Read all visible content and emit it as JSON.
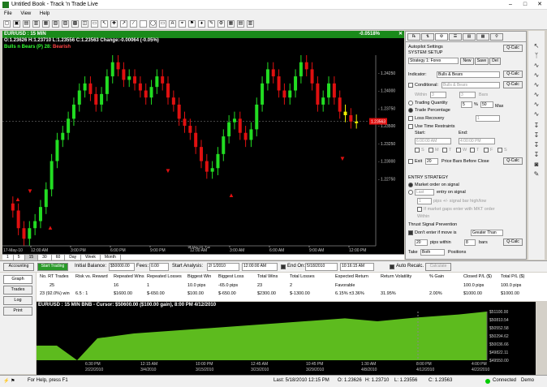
{
  "window": {
    "title": "Untitled Book - Track 'n Trade Live"
  },
  "menu": [
    "File",
    "View",
    "Help"
  ],
  "chart": {
    "header": "EUR/USD : 15 MIN",
    "change_pct": "-0.0518%",
    "ohlc": "O:1.23626   H:1.23710   L:1.23556   C:1.23563   Change:-0.00064 (-0.05%)",
    "indicator": "Bulls n Bears (P) 28:",
    "indicator_state": "Bearish",
    "price_labels": [
      "1.24250",
      "1.24000",
      "1.23750",
      "1.23500",
      "1.23250",
      "1.23000",
      "1.22750"
    ],
    "price_tag_bid": "1.23563",
    "price_tag_ask": "1.23563",
    "time_labels": [
      "12:00 AM",
      "3:00 PM",
      "6:00 PM",
      "9:00 PM",
      "12:00 AM",
      "3:00 AM",
      "6:00 AM",
      "9:00 AM",
      "12:00 PM"
    ],
    "date_labels": [
      "15-May-10, Sat",
      "18-May-10, Tue"
    ],
    "axis_corner_left": "17-May-10"
  },
  "tf_tabs": [
    "1",
    "5",
    "15",
    "30",
    "60",
    "Day",
    "Week",
    "Month"
  ],
  "panel": {
    "title": "Autopilot Settings",
    "subtitle": "SYSTEM SETUP",
    "strategy": "Strategy 1: Forex",
    "new": "New",
    "save": "Save",
    "del": "Del",
    "qcalc": "Q-Calc",
    "indicator_label": "Indicator:",
    "indicator_value": "Bulls & Bears",
    "conditional": "Conditional:",
    "conditional_value": "Bulls & Bears",
    "within": "Within",
    "within_val": "3",
    "bars_val": "3",
    "bars": "Bars",
    "trading_qty": "Trading Quantity",
    "trade_pct": "Trade Percentage",
    "trade_pct_val": "5",
    "pct_sym": "%",
    "max_val": "50",
    "max": "Max",
    "loss_recovery": "Loss Recovery",
    "loss_val": "1",
    "use_time": "Use Time Restraints",
    "start": "Start:",
    "end": "End:",
    "start_time": "6:00:00 AM",
    "end_time": "4:00:00 PM",
    "days": [
      "S",
      "M",
      "T",
      "W",
      "T",
      "F",
      "S"
    ],
    "exit": "Exit",
    "exit_val": "20",
    "price_bars_before_close": "Price Bars Before Close",
    "entry_strategy": "ENTRY STRATEGY",
    "market_order": "Market order on signal",
    "last": "Last",
    "entry_on_signal": "entry on signal",
    "pips_hint": "pips +/- signal bar high/low",
    "pips_val": "1",
    "if_market_gaps": "If market gaps enter with MKT order",
    "within_label": "Within",
    "thrust": "Thrust Signal Prevention",
    "dont_enter": "Don't enter if move is",
    "greater_than": "Greater Than",
    "pips_val2": "20",
    "pips_within": "pips within",
    "bars_val2": "8",
    "bars2": "bars",
    "take": "Take",
    "both": "Both",
    "positions": "Positions"
  },
  "strip": {
    "accounting": "Accounting",
    "start_trading": "Start Trading",
    "initial_balance": "Initial Balance:",
    "balance": "$50000.00",
    "fees": "Fees:",
    "fees_val": "0.00",
    "start_analysis": "Start Analysis:",
    "start_date": "2/ 1/2010",
    "start_time": "12:00:00 AM",
    "end_on": "End On:",
    "end_date": "5/18/2010",
    "end_time": "10:16:15 AM",
    "auto_recalc": "Auto Recalc.",
    "calculate": "Calculate"
  },
  "nav": [
    "Graph",
    "Trades",
    "Log",
    "Print"
  ],
  "stats": {
    "headers": [
      "No. RT Trades",
      "Risk vs. Reward",
      "Repeated Wins",
      "Repeated Losses",
      "Biggest Win",
      "Biggest Loss",
      "Total Wins",
      "Total Losses",
      "Expected Return",
      "Return Volatility",
      "% Gain",
      "Closed P/L ($)",
      "Total P/L ($)"
    ],
    "row1": [
      "25",
      "",
      "16",
      "1",
      "10.0 pips",
      "-65.0 pips",
      "23",
      "2",
      "Favorable",
      "",
      "",
      "100.0 pips",
      "100.0 pips"
    ],
    "row2": [
      "23 (92.0%) win",
      "6.5 : 1",
      "$1600.00",
      "$-650.00",
      "$100.00",
      "$-650.00",
      "$2300.00",
      "$-1300.00",
      "6.15% ±3.36%",
      "31.95%",
      "2.00%",
      "$1000.00",
      "$1000.00"
    ]
  },
  "equity": {
    "header": "EUR/USD : 15 MIN   BNB - Cursor: $50600.00 ($100.00 gain), 8:00 PM 4/12/2010",
    "price_labels": [
      "$51100.00",
      "$50810.54",
      "$50552.58",
      "$50294.62",
      "$50036.66",
      "$49822.11",
      "$49550.00"
    ],
    "time_labels": [
      "6:30 PM",
      "12:15 AM",
      "10:00 PM",
      "12:45 AM",
      "10:45 PM",
      "1:30 AM",
      "8:00 PM",
      "4:00 PM"
    ],
    "date_labels": [
      "2/22/2010",
      "3/4/2010",
      "3/15/2010",
      "3/23/2010",
      "3/29/2010",
      "4/8/2010",
      "4/12/2010",
      "4/22/2010"
    ]
  },
  "status": {
    "help": "For Help, press F1",
    "last": "Last: 5/18/2010 12:15 PM",
    "o": "O: 1.23626",
    "h": "H: 1.23710",
    "l": "L: 1.23556",
    "c": "C: 1.23563",
    "connected": "Connected",
    "mode": "Demo"
  },
  "colors": {
    "bull": "#22dd22",
    "bear": "#e01010",
    "neutral": "#f0f000",
    "header_green": "#1a8a1a",
    "equity": "#5dbb1e"
  }
}
